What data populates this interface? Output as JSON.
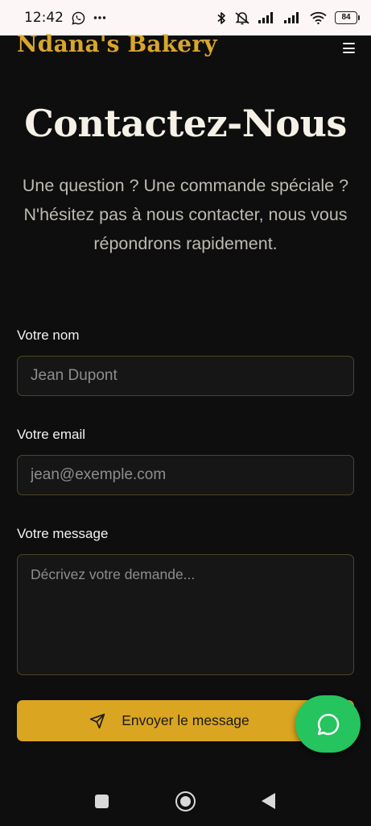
{
  "status_bar": {
    "time": "12:42",
    "battery": "84",
    "icons": [
      "whatsapp-icon",
      "more-dots-icon",
      "bluetooth-icon",
      "vibrate-off-icon",
      "signal-icon",
      "signal-icon",
      "wifi-icon",
      "battery-icon"
    ]
  },
  "header": {
    "brand": "Ndana's Bakery",
    "menu_icon": "hamburger-menu-icon"
  },
  "hero": {
    "title": "Contactez-Nous",
    "subtitle": "Une question ? Une commande spéciale ? N'hésitez pas à nous contacter, nous vous répondrons rapidement."
  },
  "form": {
    "name_label": "Votre nom",
    "name_placeholder": "Jean Dupont",
    "email_label": "Votre email",
    "email_placeholder": "jean@exemple.com",
    "message_label": "Votre message",
    "message_placeholder": "Décrivez votre demande...",
    "submit_label": "Envoyer le message",
    "submit_icon": "send-icon"
  },
  "fab": {
    "icon": "whatsapp-icon"
  },
  "nav_bar": {
    "icons": [
      "recents-icon",
      "home-icon",
      "back-icon"
    ]
  },
  "colors": {
    "accent": "#daa520",
    "brand": "#d9a62d",
    "background": "#0e0e0e",
    "whatsapp": "#25c45e"
  }
}
